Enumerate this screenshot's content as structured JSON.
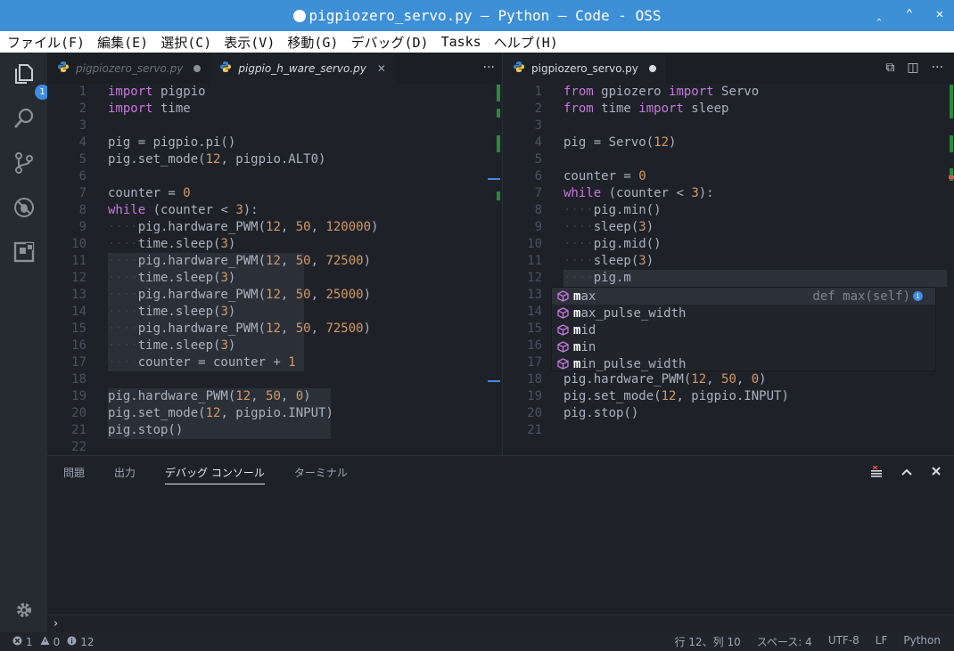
{
  "window": {
    "title": "pigpiozero_servo.py — Python — Code - OSS",
    "controls": [
      "‸",
      "⌃",
      "✕"
    ]
  },
  "menu": [
    "ファイル(F)",
    "編集(E)",
    "選択(C)",
    "表示(V)",
    "移動(G)",
    "デバッグ(D)",
    "Tasks",
    "ヘルプ(H)"
  ],
  "activity": {
    "explorer_badge": "1",
    "icons": [
      "files-icon",
      "search-icon",
      "source-control-icon",
      "debug-icon",
      "extensions-icon",
      "settings-gear-icon"
    ]
  },
  "left_group": {
    "tabs": [
      {
        "label": "pigpiozero_servo.py",
        "active": false,
        "marker": "dot"
      },
      {
        "label": "pigpio_h_ware_servo.py",
        "active": true,
        "marker": "close"
      }
    ],
    "actions_label": "···",
    "lines": [
      {
        "n": "1",
        "html": "<span class=\"kw\">import</span> pigpio"
      },
      {
        "n": "2",
        "html": "<span class=\"kw\">import</span> time"
      },
      {
        "n": "3",
        "html": ""
      },
      {
        "n": "4",
        "html": "pig = pigpio.pi()"
      },
      {
        "n": "5",
        "html": "pig.set_mode(<span class=\"num\">12</span>, pigpio.ALT0)"
      },
      {
        "n": "6",
        "html": ""
      },
      {
        "n": "7",
        "html": "counter = <span class=\"num\">0</span>"
      },
      {
        "n": "8",
        "html": "<span class=\"kw\">while</span> (counter &lt; <span class=\"num\">3</span>):"
      },
      {
        "n": "9",
        "html": "<span class=\"ind\">····</span>pig.hardware_PWM(<span class=\"num\">12</span>, <span class=\"num\">50</span>, <span class=\"num\">120000</span>)"
      },
      {
        "n": "10",
        "html": "<span class=\"ind\">····</span>time.sleep(<span class=\"num\">3</span>)"
      },
      {
        "n": "11",
        "html": "<span class=\"ind\">····</span>pig.hardware_PWM(<span class=\"num\">12</span>, <span class=\"num\">50</span>, <span class=\"num\">72500</span>)"
      },
      {
        "n": "12",
        "html": "<span class=\"ind\">····</span>time.sleep(<span class=\"num\">3</span>)"
      },
      {
        "n": "13",
        "html": "<span class=\"ind\">····</span>pig.hardware_PWM(<span class=\"num\">12</span>, <span class=\"num\">50</span>, <span class=\"num\">25000</span>)"
      },
      {
        "n": "14",
        "html": "<span class=\"ind\">····</span>time.sleep(<span class=\"num\">3</span>)"
      },
      {
        "n": "15",
        "html": "<span class=\"ind\">····</span>pig.hardware_PWM(<span class=\"num\">12</span>, <span class=\"num\">50</span>, <span class=\"num\">72500</span>)"
      },
      {
        "n": "16",
        "html": "<span class=\"ind\">····</span>time.sleep(<span class=\"num\">3</span>)"
      },
      {
        "n": "17",
        "html": "<span class=\"ind\">····</span>counter = counter + <span class=\"num\">1</span>"
      },
      {
        "n": "18",
        "html": ""
      },
      {
        "n": "19",
        "html": "pig.hardware_PWM(<span class=\"num\">12</span>, <span class=\"num\">50</span>, <span class=\"num\">0</span>)"
      },
      {
        "n": "20",
        "html": "pig.set_mode(<span class=\"num\">12</span>, pigpio.INPUT)"
      },
      {
        "n": "21",
        "html": "pig.stop()"
      },
      {
        "n": "22",
        "html": ""
      }
    ]
  },
  "right_group": {
    "tabs": [
      {
        "label": "pigpiozero_servo.py",
        "active": true,
        "marker": "dot"
      }
    ],
    "actions": [
      "⧉",
      "◫",
      "···"
    ],
    "lines": [
      {
        "n": "1",
        "html": "<span class=\"kw\">from</span> gpiozero <span class=\"kw\">import</span> Servo"
      },
      {
        "n": "2",
        "html": "<span class=\"kw\">from</span> time <span class=\"kw\">import</span> sleep"
      },
      {
        "n": "3",
        "html": ""
      },
      {
        "n": "4",
        "html": "pig = Servo(<span class=\"num\">12</span>)"
      },
      {
        "n": "5",
        "html": ""
      },
      {
        "n": "6",
        "html": "counter = <span class=\"num\">0</span>"
      },
      {
        "n": "7",
        "html": "<span class=\"kw\">while</span> (counter &lt; <span class=\"num\">3</span>):"
      },
      {
        "n": "8",
        "html": "<span class=\"ind\">····</span>pig.min()"
      },
      {
        "n": "9",
        "html": "<span class=\"ind\">····</span>sleep(<span class=\"num\">3</span>)"
      },
      {
        "n": "10",
        "html": "<span class=\"ind\">····</span>pig.mid()"
      },
      {
        "n": "11",
        "html": "<span class=\"ind\">····</span>sleep(<span class=\"num\">3</span>)"
      },
      {
        "n": "12",
        "html": "<span class=\"ind\">····</span>pig.m"
      },
      {
        "n": "13",
        "html": ""
      },
      {
        "n": "14",
        "html": ""
      },
      {
        "n": "15",
        "html": ""
      },
      {
        "n": "16",
        "html": ""
      },
      {
        "n": "17",
        "html": ""
      },
      {
        "n": "18",
        "html": "pig.hardware_PWM(<span class=\"num\">12</span>, <span class=\"num\">50</span>, <span class=\"num\">0</span>)"
      },
      {
        "n": "19",
        "html": "pig.set_mode(<span class=\"num\">12</span>, pigpio.INPUT)"
      },
      {
        "n": "20",
        "html": "pig.stop()"
      },
      {
        "n": "21",
        "html": ""
      }
    ]
  },
  "suggestions": [
    {
      "match": "m",
      "rest": "ax",
      "detail": "def max(self)",
      "selected": true
    },
    {
      "match": "m",
      "rest": "ax_pulse_width",
      "detail": "",
      "selected": false
    },
    {
      "match": "m",
      "rest": "id",
      "detail": "",
      "selected": false
    },
    {
      "match": "m",
      "rest": "in",
      "detail": "",
      "selected": false
    },
    {
      "match": "m",
      "rest": "in_pulse_width",
      "detail": "",
      "selected": false
    }
  ],
  "panel": {
    "tabs": [
      "問題",
      "出力",
      "デバッグ コンソール",
      "ターミナル"
    ],
    "active_tab": 2,
    "prompt": "›"
  },
  "status": {
    "errors": "1",
    "warnings": "0",
    "info": "12",
    "position": "行 12、列 10",
    "spaces": "スペース: 4",
    "encoding": "UTF-8",
    "eol": "LF",
    "language": "Python"
  }
}
